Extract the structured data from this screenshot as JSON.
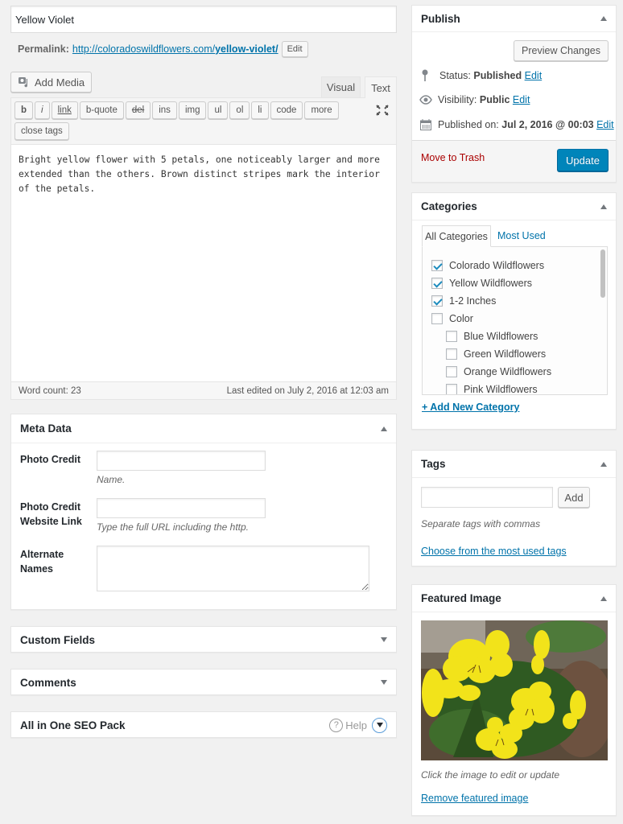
{
  "post": {
    "title": "Yellow Violet",
    "permalink_label": "Permalink:",
    "permalink_base": "http://coloradoswildflowers.com/",
    "permalink_slug": "yellow-violet/",
    "permalink_edit": "Edit"
  },
  "editor": {
    "add_media": "Add Media",
    "tabs": [
      {
        "label": "Visual",
        "active": false
      },
      {
        "label": "Text",
        "active": true
      }
    ],
    "quicktags": [
      "b",
      "i",
      "link",
      "b-quote",
      "del",
      "ins",
      "img",
      "ul",
      "ol",
      "li",
      "code",
      "more",
      "close tags"
    ],
    "content": "Bright yellow flower with 5 petals, one noticeably larger and more extended than the others. Brown distinct stripes mark the interior of the petals.",
    "word_count": "Word count: 23",
    "last_edited": "Last edited on July 2, 2016 at 12:03 am"
  },
  "meta_data": {
    "title": "Meta Data",
    "fields": [
      {
        "label": "Photo Credit",
        "value": "",
        "hint": "Name."
      },
      {
        "label": "Photo Credit Website Link",
        "value": "",
        "hint": "Type the full URL including the http."
      },
      {
        "label": "Alternate Names",
        "value": ""
      }
    ]
  },
  "collapsed_boxes": {
    "custom_fields": "Custom Fields",
    "comments": "Comments",
    "seo": "All in One SEO Pack",
    "seo_help": "Help"
  },
  "publish": {
    "title": "Publish",
    "preview": "Preview Changes",
    "status_label": "Status:",
    "status_value": "Published",
    "visibility_label": "Visibility:",
    "visibility_value": "Public",
    "published_label": "Published on:",
    "published_value": "Jul 2, 2016 @ 00:03",
    "edit": "Edit",
    "trash": "Move to Trash",
    "update": "Update"
  },
  "categories": {
    "title": "Categories",
    "tabs": [
      "All Categories",
      "Most Used"
    ],
    "items": [
      {
        "label": "Colorado Wildflowers",
        "checked": true,
        "level": 0
      },
      {
        "label": "Yellow Wildflowers",
        "checked": true,
        "level": 0
      },
      {
        "label": "1-2 Inches",
        "checked": true,
        "level": 0
      },
      {
        "label": "Color",
        "checked": false,
        "level": 0
      },
      {
        "label": "Blue Wildflowers",
        "checked": false,
        "level": 1
      },
      {
        "label": "Green Wildflowers",
        "checked": false,
        "level": 1
      },
      {
        "label": "Orange Wildflowers",
        "checked": false,
        "level": 1
      },
      {
        "label": "Pink Wildflowers",
        "checked": false,
        "level": 1
      }
    ],
    "add_new": "+ Add New Category"
  },
  "tags": {
    "title": "Tags",
    "input_value": "",
    "add": "Add",
    "hint": "Separate tags with commas",
    "choose": "Choose from the most used tags"
  },
  "featured_image": {
    "title": "Featured Image",
    "image_alt": "Yellow violet flowers",
    "hint": "Click the image to edit or update",
    "remove": "Remove featured image"
  },
  "colors": {
    "accent": "#0073aa",
    "primary_button": "#0085ba",
    "trash": "#a00",
    "background": "#f1f1f1"
  }
}
